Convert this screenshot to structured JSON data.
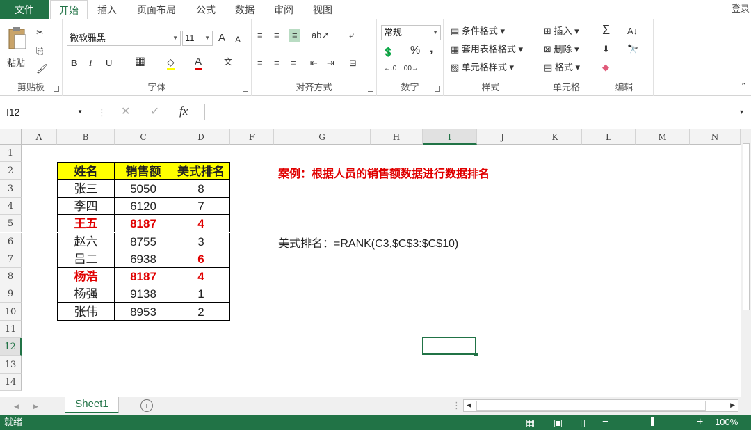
{
  "menu": {
    "file": "文件",
    "tabs": [
      "开始",
      "插入",
      "页面布局",
      "公式",
      "数据",
      "审阅",
      "视图"
    ],
    "login": "登录"
  },
  "ribbon": {
    "clipboard": {
      "label": "剪贴板",
      "paste": "粘贴"
    },
    "font": {
      "label": "字体",
      "name": "微软雅黑",
      "size": "11",
      "bold": "B",
      "italic": "I",
      "underline": "U",
      "grow": "A",
      "shrink": "A",
      "color_a": "A"
    },
    "align": {
      "label": "对齐方式"
    },
    "number": {
      "label": "数字",
      "format": "常规",
      "percent": "%",
      "comma": ","
    },
    "styles": {
      "label": "样式",
      "conditional": "条件格式",
      "table": "套用表格格式",
      "cell": "单元格样式"
    },
    "cells": {
      "label": "单元格",
      "insert": "插入",
      "delete": "删除",
      "format": "格式"
    },
    "editing": {
      "label": "编辑",
      "sum": "Σ"
    }
  },
  "formula_bar": {
    "name_box": "I12",
    "fx": "fx",
    "formula": ""
  },
  "grid": {
    "columns": [
      "A",
      "B",
      "C",
      "D",
      "F",
      "G",
      "H",
      "I",
      "J",
      "K",
      "L",
      "M",
      "N"
    ],
    "selected_column": "I",
    "rows": [
      "1",
      "2",
      "3",
      "4",
      "5",
      "6",
      "7",
      "8",
      "9",
      "10",
      "11",
      "12",
      "13",
      "14"
    ],
    "selected_row": "12"
  },
  "table": {
    "headers": [
      "姓名",
      "销售额",
      "美式排名"
    ],
    "rows": [
      {
        "name": "张三",
        "sales": "5050",
        "rank": "8",
        "red_name": false,
        "red_rank": false
      },
      {
        "name": "李四",
        "sales": "6120",
        "rank": "7",
        "red_name": false,
        "red_rank": false
      },
      {
        "name": "王五",
        "sales": "8187",
        "rank": "4",
        "red_name": true,
        "red_rank": true
      },
      {
        "name": "赵六",
        "sales": "8755",
        "rank": "3",
        "red_name": false,
        "red_rank": false
      },
      {
        "name": "吕二",
        "sales": "6938",
        "rank": "6",
        "red_name": false,
        "red_rank": true
      },
      {
        "name": "杨浩",
        "sales": "8187",
        "rank": "4",
        "red_name": true,
        "red_rank": true
      },
      {
        "name": "杨强",
        "sales": "9138",
        "rank": "1",
        "red_name": false,
        "red_rank": false
      },
      {
        "name": "张伟",
        "sales": "8953",
        "rank": "2",
        "red_name": false,
        "red_rank": false
      }
    ]
  },
  "notes": {
    "case_title": "案例：根据人员的销售额数据进行数据排名",
    "formula_text": "美式排名：=RANK(C3,$C$3:$C$10)"
  },
  "sheet_tabs": {
    "active": "Sheet1",
    "add": "+"
  },
  "status": {
    "ready": "就绪",
    "zoom": "100%"
  },
  "colors": {
    "excel_green": "#217346",
    "header_yellow": "#ffff00",
    "red": "#e00000"
  }
}
